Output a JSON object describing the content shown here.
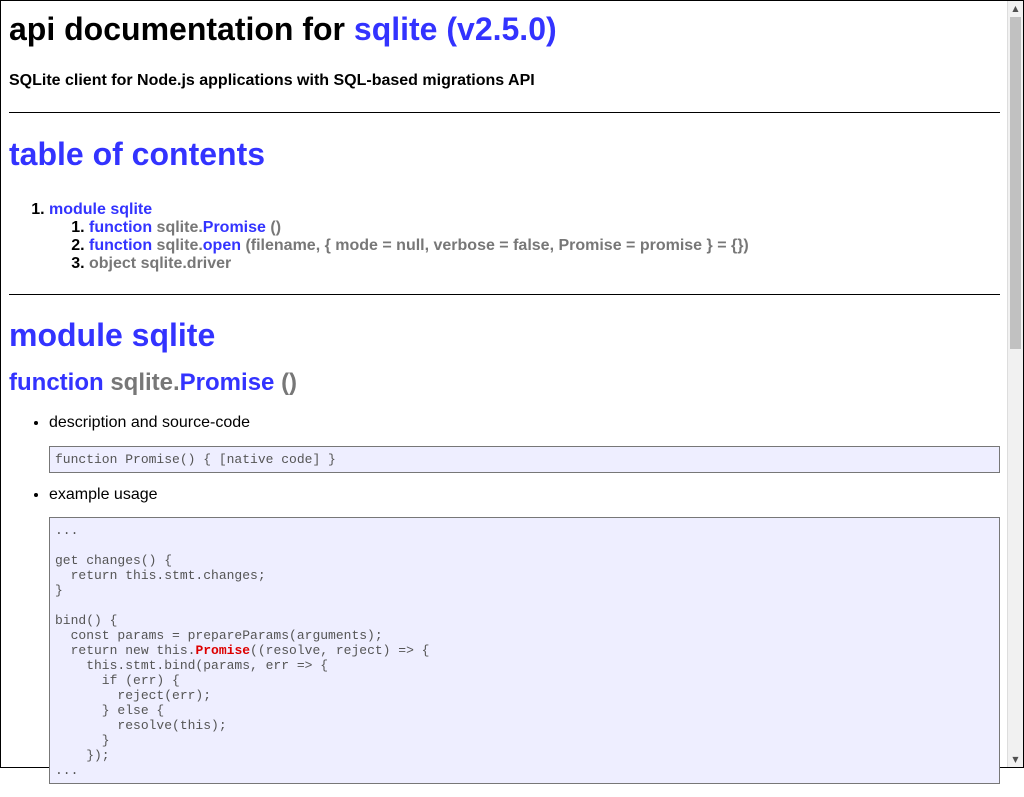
{
  "header": {
    "title_prefix": "api documentation for",
    "package_name": "sqlite",
    "version": "(v2.5.0)",
    "description": "SQLite client for Node.js applications with SQL-based migrations API"
  },
  "toc": {
    "title": "table of contents",
    "module_label": "module sqlite",
    "items": [
      {
        "kind": "function",
        "owner": "sqlite.",
        "name": "Promise",
        "signature": "()"
      },
      {
        "kind": "function",
        "owner": "sqlite.",
        "name": "open",
        "signature": "(filename, { mode = null, verbose = false, Promise = promise } = {})"
      },
      {
        "text": "object sqlite.driver"
      }
    ]
  },
  "module": {
    "title": "module sqlite",
    "function": {
      "kind": "function",
      "owner": "sqlite.",
      "name": "Promise",
      "signature": "()",
      "description_label": "description and source-code",
      "source_code": "function Promise() { [native code] }",
      "example_label": "example usage",
      "example_before": "...\n\nget changes() {\n  return this.stmt.changes;\n}\n\nbind() {\n  const params = prepareParams(arguments);\n  return new this.",
      "example_highlight": "Promise",
      "example_after": "((resolve, reject) => {\n    this.stmt.bind(params, err => {\n      if (err) {\n        reject(err);\n      } else {\n        resolve(this);\n      }\n    });\n..."
    }
  },
  "scrollbar": {
    "up_icon": "triangle-up",
    "down_icon": "triangle-down"
  }
}
